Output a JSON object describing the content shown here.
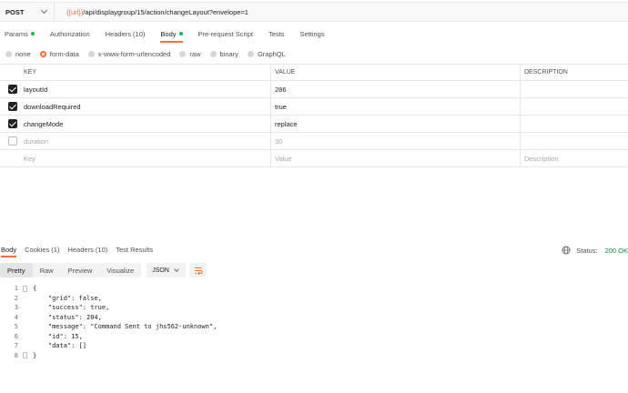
{
  "request": {
    "method": "POST",
    "url_var": "{{url}}",
    "url_path": "/api/displaygroup/15/action/changeLayout?envelope=1"
  },
  "request_tabs": [
    {
      "label": "Params",
      "dot": true
    },
    {
      "label": "Authorization",
      "dot": false
    },
    {
      "label": "Headers (10)",
      "dot": false
    },
    {
      "label": "Body",
      "dot": true,
      "active": true
    },
    {
      "label": "Pre-request Script",
      "dot": false
    },
    {
      "label": "Tests",
      "dot": false
    },
    {
      "label": "Settings",
      "dot": false
    }
  ],
  "body_types": [
    {
      "label": "none",
      "selected": false
    },
    {
      "label": "form-data",
      "selected": true
    },
    {
      "label": "x-www-form-urlencoded",
      "selected": false
    },
    {
      "label": "raw",
      "selected": false
    },
    {
      "label": "binary",
      "selected": false
    },
    {
      "label": "GraphQL",
      "selected": false
    }
  ],
  "params_table": {
    "headers": {
      "key": "KEY",
      "value": "VALUE",
      "description": "DESCRIPTION"
    },
    "rows": [
      {
        "key": "layoutId",
        "value": "286",
        "checked": true
      },
      {
        "key": "downloadRequired",
        "value": "true",
        "checked": true
      },
      {
        "key": "changeMode",
        "value": "replace",
        "checked": true
      },
      {
        "key": "duration",
        "value": "30",
        "checked": false
      }
    ],
    "placeholder": {
      "key": "Key",
      "value": "Value",
      "description": "Description"
    }
  },
  "response_tabs": [
    {
      "label": "Body",
      "active": true
    },
    {
      "label": "Cookies (1)",
      "active": false
    },
    {
      "label": "Headers (10)",
      "active": false
    },
    {
      "label": "Test Results",
      "active": false
    }
  ],
  "status": {
    "label": "Status:",
    "code": "200 OK",
    "icon": "globe-icon"
  },
  "view_modes": [
    "Pretty",
    "Raw",
    "Preview",
    "Visualize"
  ],
  "format": "JSON",
  "response_lines": [
    {
      "n": "1",
      "text": "{"
    },
    {
      "n": "2",
      "text": "    \"grid\": false,"
    },
    {
      "n": "3",
      "text": "    \"success\": true,"
    },
    {
      "n": "4",
      "text": "    \"status\": 204,"
    },
    {
      "n": "5",
      "text": "    \"message\": \"Command Sent to jhs562-unknown\","
    },
    {
      "n": "6",
      "text": "    \"id\": 15,"
    },
    {
      "n": "7",
      "text": "    \"data\": []"
    },
    {
      "n": "8",
      "text": "}"
    }
  ],
  "colors": {
    "accent": "#ff6c37",
    "dot": "#0cbb52",
    "status_ok": "#0a8f3c"
  }
}
